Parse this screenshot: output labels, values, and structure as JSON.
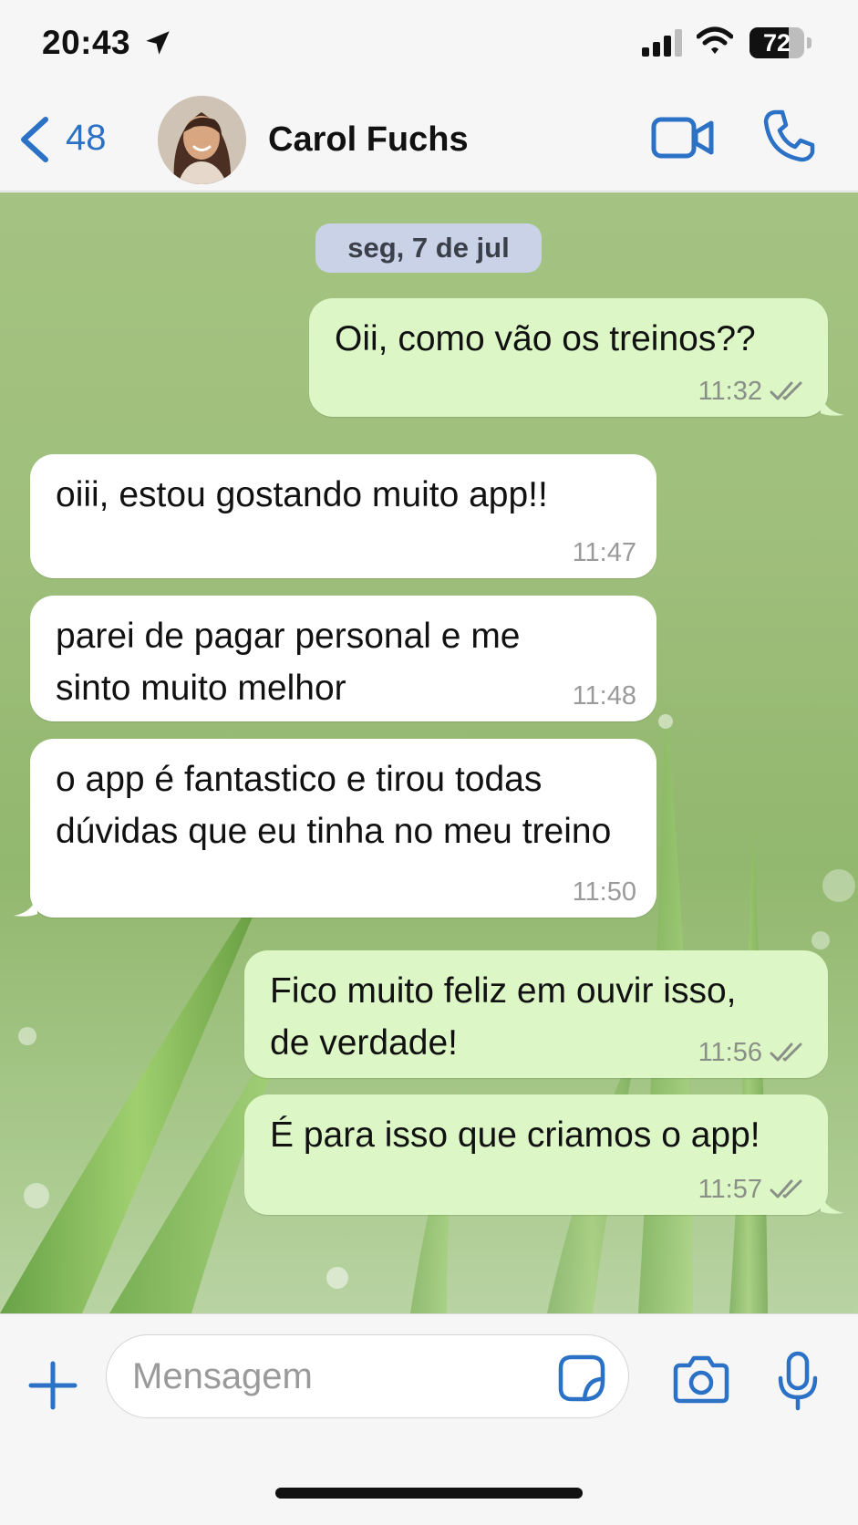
{
  "status_bar": {
    "time": "20:43",
    "battery_level": "72",
    "battery_fraction": 0.72,
    "icons": [
      "location-arrow-icon",
      "signal-bars-icon",
      "wifi-icon",
      "battery-icon"
    ]
  },
  "header": {
    "back_count": "48",
    "contact_name": "Carol Fuchs",
    "icons": [
      "chevron-left-icon",
      "video-camera-icon",
      "phone-icon"
    ]
  },
  "chat": {
    "date_label": "seg, 7 de jul",
    "messages": [
      {
        "direction": "out",
        "text": "Oii, como vão os treinos??",
        "time": "11:32",
        "status": "read"
      },
      {
        "direction": "in",
        "text": "oiii, estou gostando muito app!!",
        "time": "11:47"
      },
      {
        "direction": "in",
        "text": "parei de pagar personal e me sinto muito melhor",
        "time": "11:48"
      },
      {
        "direction": "in",
        "text": "o app é fantastico e tirou todas dúvidas que eu tinha no meu treino",
        "time": "11:50"
      },
      {
        "direction": "out",
        "text": "Fico muito feliz em ouvir isso, de verdade!",
        "time": "11:56",
        "status": "read"
      },
      {
        "direction": "out",
        "text": "É para isso que criamos o app!",
        "time": "11:57",
        "status": "read"
      }
    ]
  },
  "composer": {
    "placeholder": "Mensagem",
    "value": "",
    "icons": [
      "plus-icon",
      "sticker-icon",
      "camera-icon",
      "microphone-icon"
    ]
  },
  "colors": {
    "accent": "#2b71c6",
    "outgoing_bubble": "#dcf6c6",
    "incoming_bubble": "#ffffff",
    "date_chip": "#c9d2e6",
    "wallpaper": "#9fbf7c"
  }
}
